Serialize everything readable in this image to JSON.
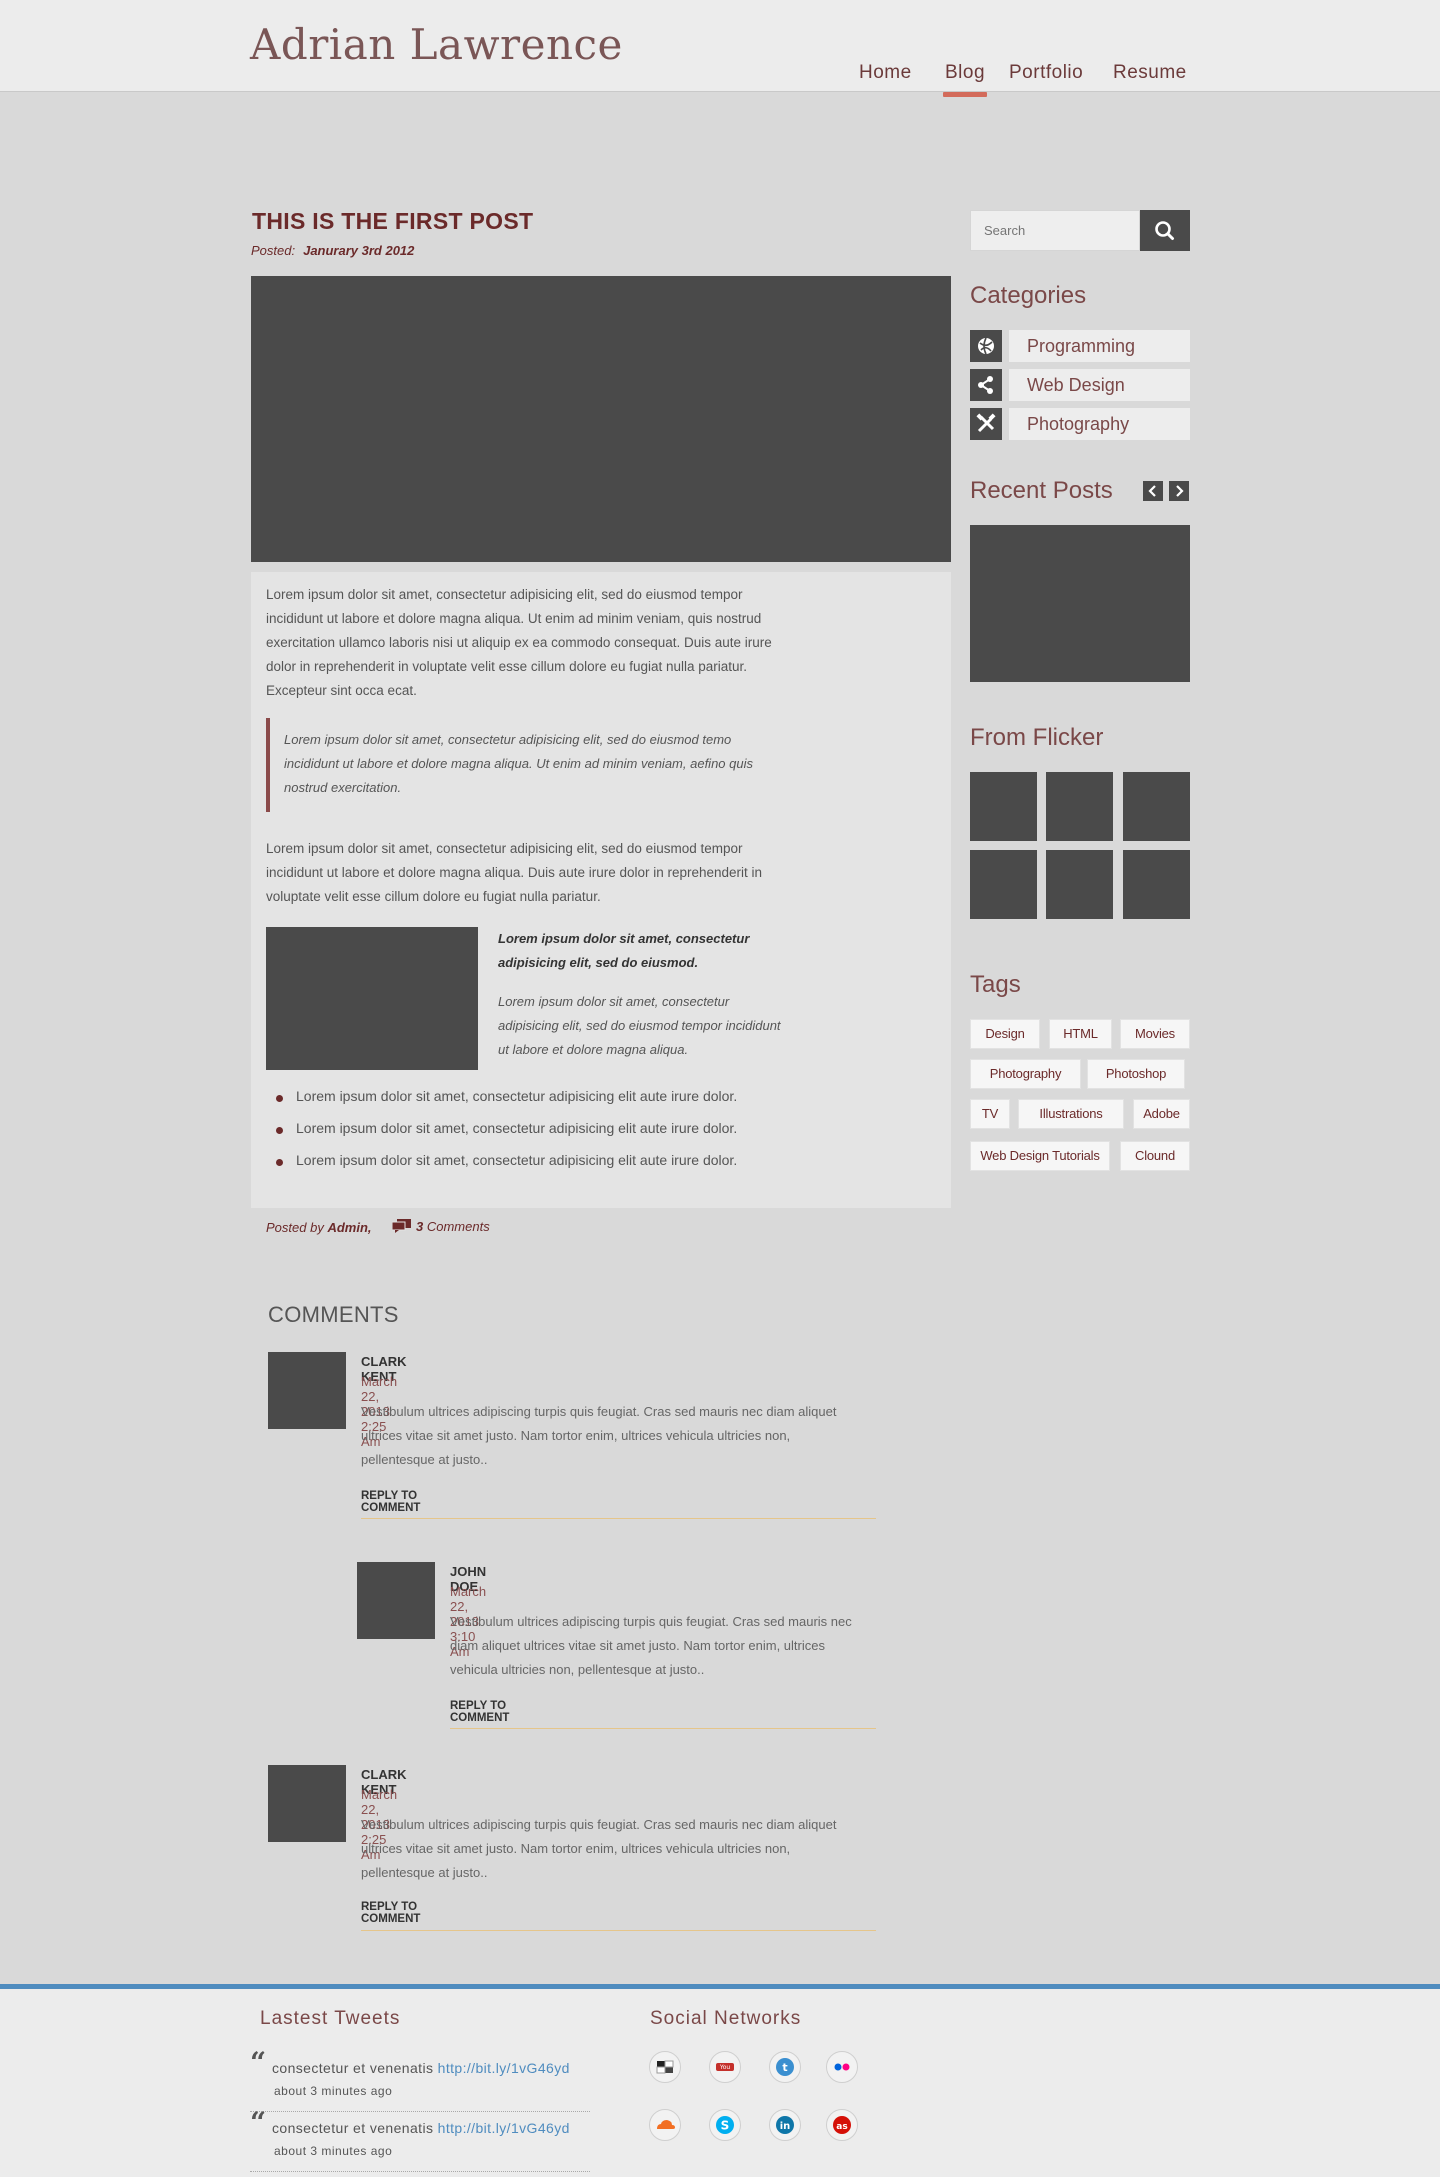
{
  "header": {
    "logo": "Adrian Lawrence",
    "nav": [
      {
        "label": "Home",
        "active": false
      },
      {
        "label": "Blog",
        "active": true
      },
      {
        "label": "Portfolio",
        "active": false
      },
      {
        "label": "Resume",
        "active": false
      }
    ]
  },
  "post": {
    "title": "THIS IS THE FIRST POST",
    "posted_label": "Posted:",
    "date": "Janurary 3rd 2012",
    "para1": "Lorem ipsum dolor sit amet, consectetur adipisicing elit, sed do eiusmod tempor incididunt ut labore et dolore magna aliqua. Ut enim ad minim veniam, quis nostrud exercitation ullamco laboris nisi ut aliquip ex ea commodo consequat. Duis aute irure dolor in reprehenderit in voluptate velit esse cillum dolore eu fugiat nulla pariatur. Excepteur sint occa ecat.",
    "quote": "Lorem ipsum dolor sit amet, consectetur adipisicing elit, sed do eiusmod temo incididunt ut labore et dolore magna aliqua. Ut enim ad minim veniam, aefino quis nostrud exercitation.",
    "para2": "Lorem ipsum dolor sit amet, consectetur adipisicing elit, sed do eiusmod tempor incididunt ut labore et dolore magna aliqua. Duis aute irure dolor in reprehenderit in voluptate velit esse cillum dolore eu fugiat nulla pariatur.",
    "side_bold": "Lorem ipsum dolor sit amet, consectetur adipisicing elit, sed do eiusmod.",
    "side_italic": "Lorem ipsum dolor sit amet, consectetur adipisicing elit, sed do eiusmod tempor incididunt ut labore et dolore magna aliqua.",
    "bullets": [
      "Lorem ipsum dolor sit amet, consectetur adipisicing elit aute irure dolor.",
      "Lorem ipsum dolor sit amet, consectetur adipisicing elit aute irure dolor.",
      "Lorem ipsum dolor sit amet, consectetur adipisicing elit aute irure dolor."
    ],
    "posted_by_label": "Posted by",
    "author": "Admin,",
    "comment_count": "3",
    "comments_word": "Comments"
  },
  "comments": {
    "heading": "COMMENTS",
    "items": [
      {
        "name": "CLARK KENT",
        "date": "March 22, 2013  2:25 Am",
        "text": "Vestibulum ultrices adipiscing turpis quis feugiat. Cras sed mauris nec diam aliquet ultrices vitae sit amet justo. Nam tortor enim, ultrices vehicula ultricies non, pellentesque at justo..",
        "reply": "REPLY TO COMMENT"
      },
      {
        "name": "JOHN DOE",
        "date": "March 22, 2013  3:10 Am",
        "text": "Vestibulum ultrices adipiscing turpis quis feugiat. Cras sed mauris nec diam aliquet ultrices vitae sit amet justo. Nam tortor enim, ultrices vehicula ultricies non, pellentesque at justo..",
        "reply": "REPLY TO COMMENT"
      },
      {
        "name": "CLARK KENT",
        "date": "March 22, 2013  2:25 Am",
        "text": "Vestibulum ultrices adipiscing turpis quis feugiat. Cras sed mauris nec diam aliquet ultrices vitae sit amet justo. Nam tortor enim, ultrices vehicula ultricies non, pellentesque at justo..",
        "reply": "REPLY TO COMMENT"
      }
    ]
  },
  "sidebar": {
    "search_placeholder": "Search",
    "categories_title": "Categories",
    "categories": [
      {
        "label": "Programming",
        "icon": "globe-icon"
      },
      {
        "label": "Web Design",
        "icon": "share-icon"
      },
      {
        "label": "Photography",
        "icon": "tools-icon"
      }
    ],
    "recent_title": "Recent Posts",
    "flicker_title": "From Flicker",
    "tags_title": "Tags",
    "tags": [
      "Design",
      "HTML",
      "Movies",
      "Photography",
      "Photoshop",
      "TV",
      "Illustrations",
      "Adobe",
      "Web Design Tutorials",
      "Clound"
    ]
  },
  "footer": {
    "tweets_title": "Lastest Tweets",
    "tweets": [
      {
        "text": "consectetur et venenatis",
        "link": "http://bit.ly/1vG46yd",
        "ago": "about 3 minutes ago"
      },
      {
        "text": "consectetur et venenatis",
        "link": "http://bit.ly/1vG46yd",
        "ago": "about 3 minutes ago"
      }
    ],
    "social_title": "Social Networks",
    "social": [
      "delicious-icon",
      "youtube-icon",
      "twitter-icon",
      "flickr-icon",
      "soundcloud-icon",
      "skype-icon",
      "linkedin-icon",
      "lastfm-icon"
    ]
  },
  "colors": {
    "accent": "#6b2a2a",
    "nav_underline": "#d36b5b",
    "footer_border": "#4f8cbf",
    "placeholder_block": "#4a4a4a"
  }
}
